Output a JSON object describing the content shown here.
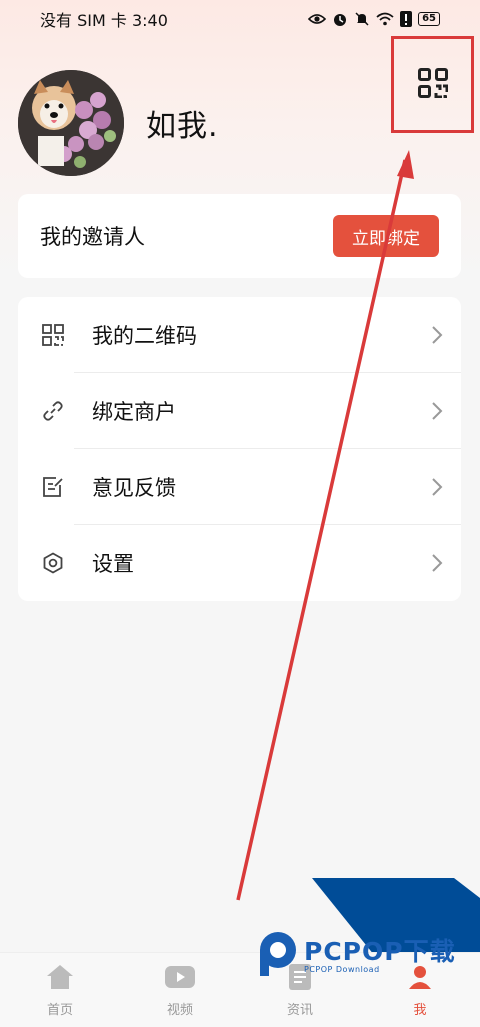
{
  "status_bar": {
    "carrier_time": "没有 SIM 卡 3:40",
    "battery": "65",
    "icons": [
      "eye-icon",
      "alarm-icon",
      "mute-icon",
      "wifi-icon",
      "alert-icon",
      "battery-icon"
    ]
  },
  "profile": {
    "username": "如我.",
    "avatar_icon": "dog-with-flowers-avatar"
  },
  "qr_button": {
    "icon": "qr-code-icon",
    "highlight_color": "#d93a3a"
  },
  "invite": {
    "label": "我的邀请人",
    "button_label": "立即绑定"
  },
  "menu": {
    "items": [
      {
        "label": "我的二维码",
        "icon": "qr-code-icon"
      },
      {
        "label": "绑定商户",
        "icon": "link-icon"
      },
      {
        "label": "意见反馈",
        "icon": "edit-note-icon"
      },
      {
        "label": "设置",
        "icon": "settings-icon"
      }
    ]
  },
  "tabbar": {
    "tabs": [
      {
        "label": "首页",
        "icon": "home-icon"
      },
      {
        "label": "视频",
        "icon": "play-icon"
      },
      {
        "label": "资讯",
        "icon": "news-icon"
      },
      {
        "label": "我",
        "icon": "profile-icon"
      }
    ]
  },
  "watermark": {
    "main": "PCPOP下载",
    "sub": "PCPOP Download"
  },
  "colors": {
    "accent": "#e4513d",
    "annotation": "#d93a3a",
    "watermark_blue": "#004c97"
  }
}
